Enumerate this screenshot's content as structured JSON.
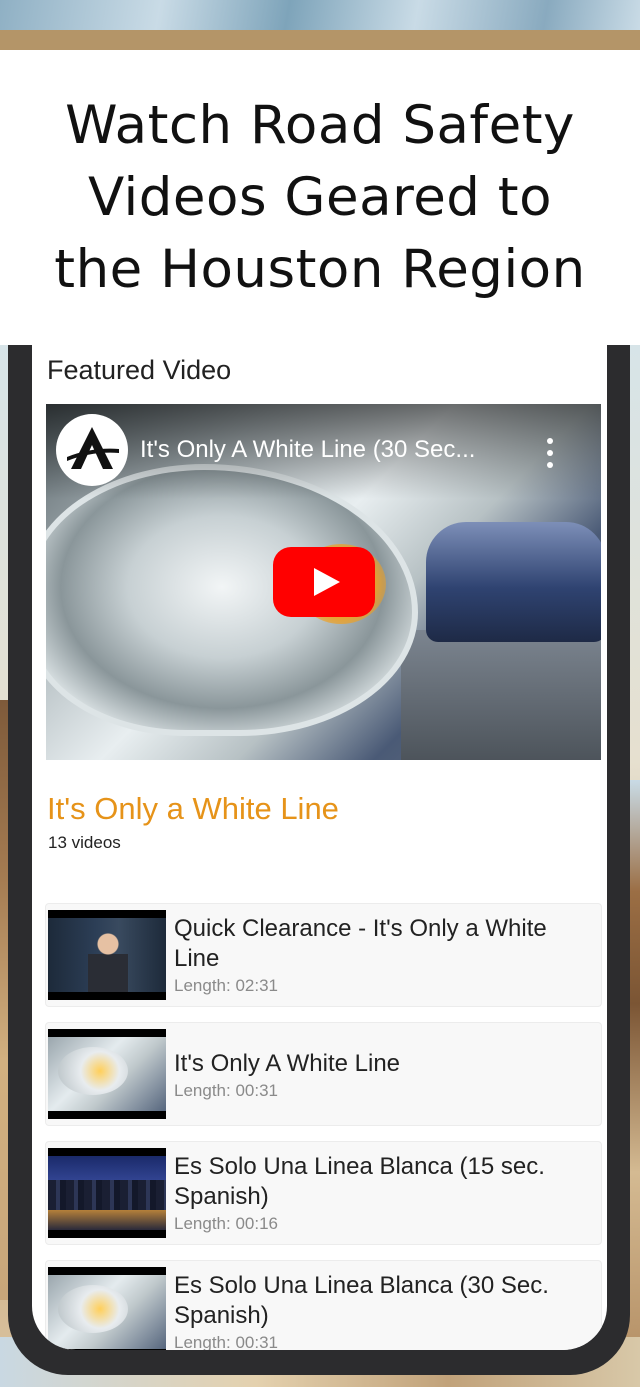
{
  "header": {
    "headline_line1": "Watch Road Safety",
    "headline_line2": "Videos Geared to",
    "headline_line3": "the Houston Region"
  },
  "featured": {
    "section_title": "Featured Video",
    "player": {
      "video_title": "It's Only A White Line (30 Sec...",
      "play_icon": "youtube-play-icon",
      "menu_icon": "kebab-menu-icon"
    }
  },
  "playlist": {
    "title": "It's Only a White Line",
    "count": "13 videos",
    "items": [
      {
        "title": "Quick Clearance - It's Only a White Line",
        "length": "Length: 02:31",
        "thumb": "news-anchor-thumbnail"
      },
      {
        "title": "It's Only A White Line",
        "length": "Length: 00:31",
        "thumb": "headlight-thumbnail"
      },
      {
        "title": "Es Solo Una Linea Blanca (15 sec. Spanish)",
        "length": "Length: 00:16",
        "thumb": "city-night-thumbnail"
      },
      {
        "title": "Es Solo Una Linea Blanca (30 Sec. Spanish)",
        "length": "Length: 00:31",
        "thumb": "headlight-thumbnail"
      }
    ]
  },
  "colors": {
    "accent_orange": "#e69319",
    "youtube_red": "#ff0000",
    "phone_frame": "#2c2c2e"
  }
}
